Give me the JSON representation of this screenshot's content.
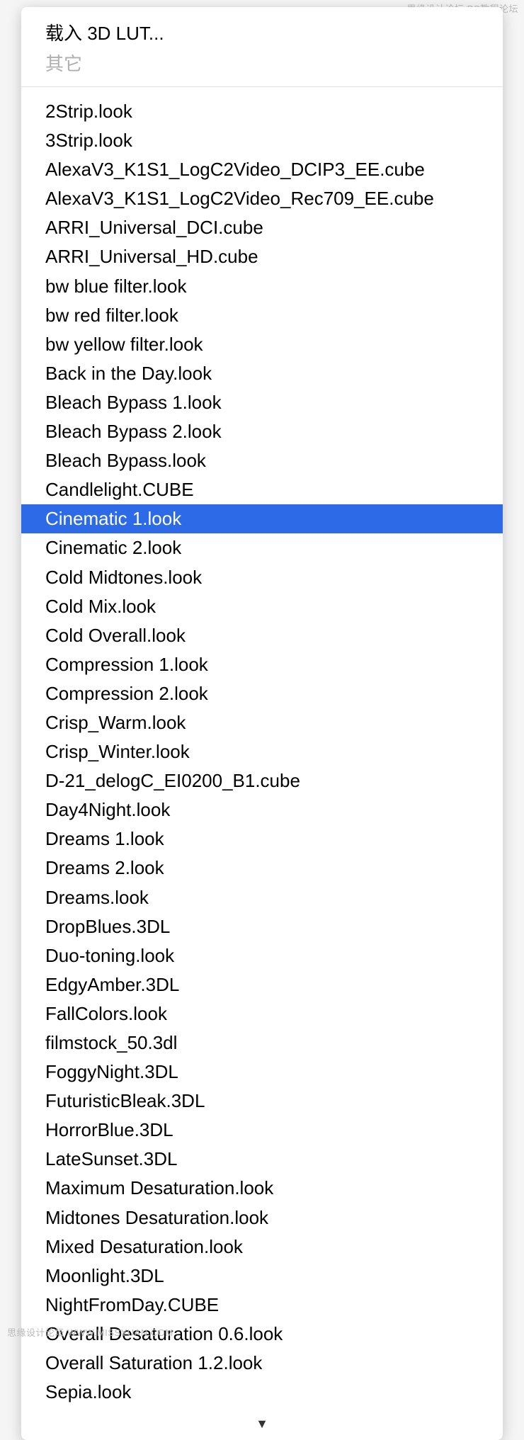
{
  "watermark": {
    "top": "思缘设计论坛  PS教程论坛",
    "bottom": "思缘设计论坛  WWW.MISSYUAN.COM"
  },
  "header": {
    "load_label": "载入 3D LUT...",
    "other_label": "其它"
  },
  "selected_index": 14,
  "scroll_arrow": "▼",
  "items": [
    "2Strip.look",
    "3Strip.look",
    "AlexaV3_K1S1_LogC2Video_DCIP3_EE.cube",
    "AlexaV3_K1S1_LogC2Video_Rec709_EE.cube",
    "ARRI_Universal_DCI.cube",
    "ARRI_Universal_HD.cube",
    "bw blue filter.look",
    "bw red filter.look",
    "bw yellow filter.look",
    "Back in the Day.look",
    "Bleach Bypass 1.look",
    "Bleach Bypass 2.look",
    "Bleach Bypass.look",
    "Candlelight.CUBE",
    "Cinematic 1.look",
    "Cinematic 2.look",
    "Cold Midtones.look",
    "Cold Mix.look",
    "Cold Overall.look",
    "Compression 1.look",
    "Compression 2.look",
    "Crisp_Warm.look",
    "Crisp_Winter.look",
    "D-21_delogC_EI0200_B1.cube",
    "Day4Night.look",
    "Dreams 1.look",
    "Dreams 2.look",
    "Dreams.look",
    "DropBlues.3DL",
    "Duo-toning.look",
    "EdgyAmber.3DL",
    "FallColors.look",
    "filmstock_50.3dl",
    "FoggyNight.3DL",
    "FuturisticBleak.3DL",
    "HorrorBlue.3DL",
    "LateSunset.3DL",
    "Maximum Desaturation.look",
    "Midtones Desaturation.look",
    "Mixed Desaturation.look",
    "Moonlight.3DL",
    "NightFromDay.CUBE",
    "Overall Desaturation 0.6.look",
    "Overall Saturation 1.2.look",
    "Sepia.look"
  ]
}
